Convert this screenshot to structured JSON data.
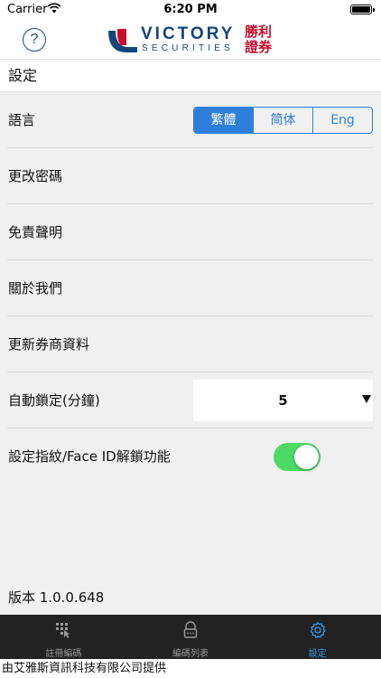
{
  "status_bar": {
    "carrier": "Carrier",
    "time": "6:20 PM"
  },
  "header": {
    "help_label": "?",
    "logo": {
      "brand": "VICTORY",
      "sub": "SECURITIES",
      "cn_line1": "勝利",
      "cn_line2": "證券"
    },
    "brand_colors": {
      "navy": "#13467a",
      "red": "#c8102e"
    }
  },
  "page": {
    "title": "設定"
  },
  "settings": {
    "language": {
      "label": "語言",
      "options": [
        "繁體",
        "简体",
        "Eng"
      ],
      "selected": "繁體"
    },
    "change_password": "更改密碼",
    "disclaimer": "免責聲明",
    "about_us": "關於我們",
    "update_broker": "更新券商資料",
    "auto_lock": {
      "label": "自動鎖定(分鐘)",
      "value": "5"
    },
    "biometric": {
      "label": "設定指紋/Face ID解鎖功能",
      "enabled": true
    }
  },
  "version": "版本 1.0.0.648",
  "tabs": [
    {
      "label": "註冊編碼",
      "icon": "keypad-icon",
      "active": false
    },
    {
      "label": "編碼列表",
      "icon": "lock-icon",
      "active": false
    },
    {
      "label": "設定",
      "icon": "gear-icon",
      "active": true
    }
  ],
  "footer": {
    "text": "由艾雅斯資訊科技有限公司提供"
  },
  "colors": {
    "accent": "#2e7fd9",
    "toggle_on": "#4cd964",
    "tab_active": "#2e9be8"
  }
}
